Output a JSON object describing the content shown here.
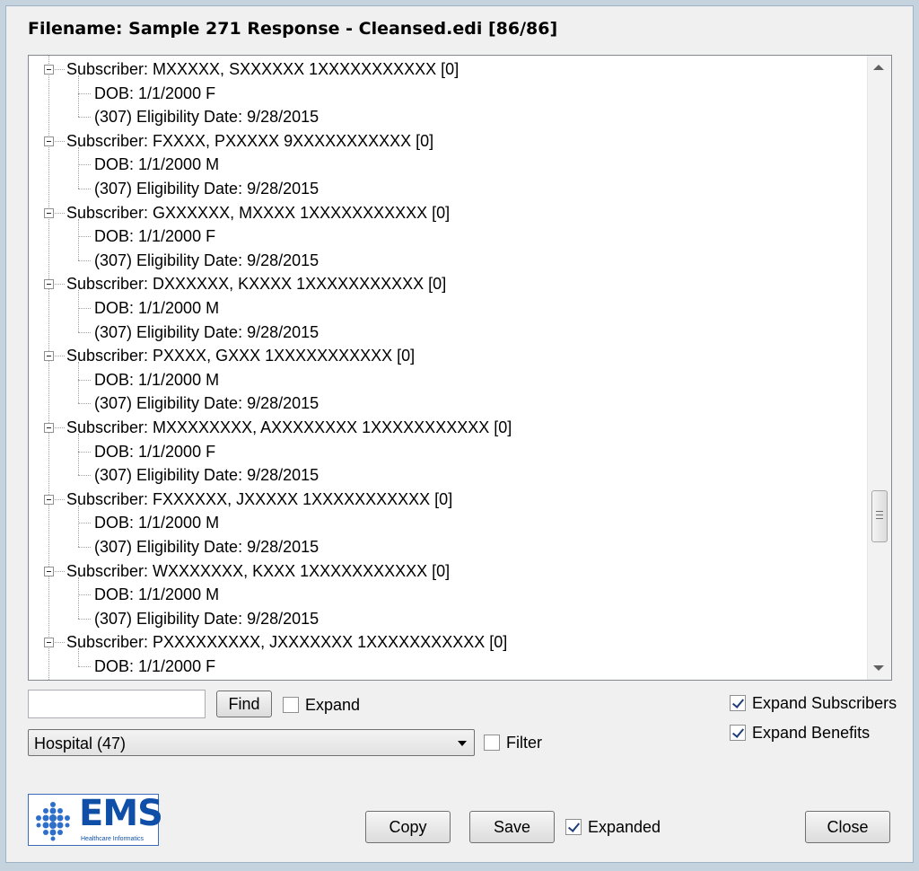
{
  "window": {
    "title": "Filename: Sample 271 Response - Cleansed.edi  [86/86]"
  },
  "tree": {
    "nodes": [
      {
        "level": 1,
        "text": "Subscriber: MXXXXX, SXXXXXX  1XXXXXXXXXXX  [0]"
      },
      {
        "level": 2,
        "text": "DOB: 1/1/2000  F"
      },
      {
        "level": 2,
        "text": "(307)  Eligibility Date: 9/28/2015"
      },
      {
        "level": 1,
        "text": "Subscriber: FXXXX, PXXXXX  9XXXXXXXXXXX  [0]"
      },
      {
        "level": 2,
        "text": "DOB: 1/1/2000  M"
      },
      {
        "level": 2,
        "text": "(307)  Eligibility Date: 9/28/2015"
      },
      {
        "level": 1,
        "text": "Subscriber: GXXXXXX, MXXXX  1XXXXXXXXXXX  [0]"
      },
      {
        "level": 2,
        "text": "DOB: 1/1/2000  F"
      },
      {
        "level": 2,
        "text": "(307)  Eligibility Date: 9/28/2015"
      },
      {
        "level": 1,
        "text": "Subscriber: DXXXXXX, KXXXX  1XXXXXXXXXXX  [0]"
      },
      {
        "level": 2,
        "text": "DOB: 1/1/2000  M"
      },
      {
        "level": 2,
        "text": "(307)  Eligibility Date: 9/28/2015"
      },
      {
        "level": 1,
        "text": "Subscriber: PXXXX, GXXX  1XXXXXXXXXXX  [0]"
      },
      {
        "level": 2,
        "text": "DOB: 1/1/2000  M"
      },
      {
        "level": 2,
        "text": "(307)  Eligibility Date: 9/28/2015"
      },
      {
        "level": 1,
        "text": "Subscriber: MXXXXXXXX, AXXXXXXXX  1XXXXXXXXXXX  [0]"
      },
      {
        "level": 2,
        "text": "DOB: 1/1/2000  F"
      },
      {
        "level": 2,
        "text": "(307)  Eligibility Date: 9/28/2015"
      },
      {
        "level": 1,
        "text": "Subscriber: FXXXXXX, JXXXXX  1XXXXXXXXXXX  [0]"
      },
      {
        "level": 2,
        "text": "DOB: 1/1/2000  M"
      },
      {
        "level": 2,
        "text": "(307)  Eligibility Date: 9/28/2015"
      },
      {
        "level": 1,
        "text": "Subscriber: WXXXXXXX, KXXX  1XXXXXXXXXXX  [0]"
      },
      {
        "level": 2,
        "text": "DOB: 1/1/2000  M"
      },
      {
        "level": 2,
        "text": "(307)  Eligibility Date: 9/28/2015"
      },
      {
        "level": 1,
        "text": "Subscriber: PXXXXXXXXX, JXXXXXXX  1XXXXXXXXXXX  [0]"
      },
      {
        "level": 2,
        "text": "DOB: 1/1/2000  F"
      }
    ]
  },
  "search": {
    "value": "",
    "find_label": "Find",
    "expand_label": "Expand",
    "expand_checked": false
  },
  "filter": {
    "selected": "Hospital  (47)",
    "filter_label": "Filter",
    "filter_checked": false
  },
  "options": {
    "expand_subscribers_label": "Expand Subscribers",
    "expand_subscribers_checked": true,
    "expand_benefits_label": "Expand Benefits",
    "expand_benefits_checked": true
  },
  "footer": {
    "copy_label": "Copy",
    "save_label": "Save",
    "expanded_label": "Expanded",
    "expanded_checked": true,
    "close_label": "Close"
  },
  "logo": {
    "text": "EMS",
    "subtext": "Healthcare Informatics"
  },
  "colors": {
    "accent": "#1f3d7a",
    "logo_blue": "#0f4fa8"
  },
  "icons": {
    "collapse": "minus-box-icon",
    "dropdown": "chevron-down-icon",
    "scroll_up": "arrow-up-icon",
    "scroll_down": "arrow-down-icon",
    "check": "checkmark-icon"
  }
}
